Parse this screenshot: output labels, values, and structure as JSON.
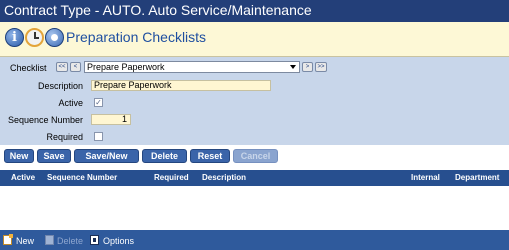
{
  "window": {
    "title": "Contract Type - AUTO. Auto Service/Maintenance"
  },
  "header": {
    "icons": [
      "info-icon",
      "clock-icon",
      "navigation-icon"
    ],
    "title": "Preparation Checklists"
  },
  "form": {
    "checklist_label": "Checklist",
    "checklist_selected": "Prepare Paperwork",
    "nav_first": "<<",
    "nav_prev": "<",
    "nav_next": ">",
    "nav_last": ">>",
    "description_label": "Description",
    "description_value": "Prepare Paperwork",
    "active_label": "Active",
    "active_checked": true,
    "sequence_label": "Sequence Number",
    "sequence_value": "1",
    "required_label": "Required",
    "required_checked": false
  },
  "buttons": {
    "new": "New",
    "save": "Save",
    "save_new": "Save/New",
    "delete": "Delete",
    "reset": "Reset",
    "cancel": "Cancel"
  },
  "table": {
    "columns": [
      "Active",
      "Sequence Number",
      "Required",
      "Description",
      "Internal",
      "Department"
    ],
    "rows": []
  },
  "footer": {
    "new": "New",
    "delete": "Delete",
    "options": "Options"
  },
  "colors": {
    "titlebar": "#233f79",
    "header_bg": "#fdf8d6",
    "form_bg": "#c8d6ea",
    "button": "#3a64a9",
    "table_header": "#274f8f",
    "footer": "#2f5a9c",
    "input_bg": "#fff6d2"
  }
}
